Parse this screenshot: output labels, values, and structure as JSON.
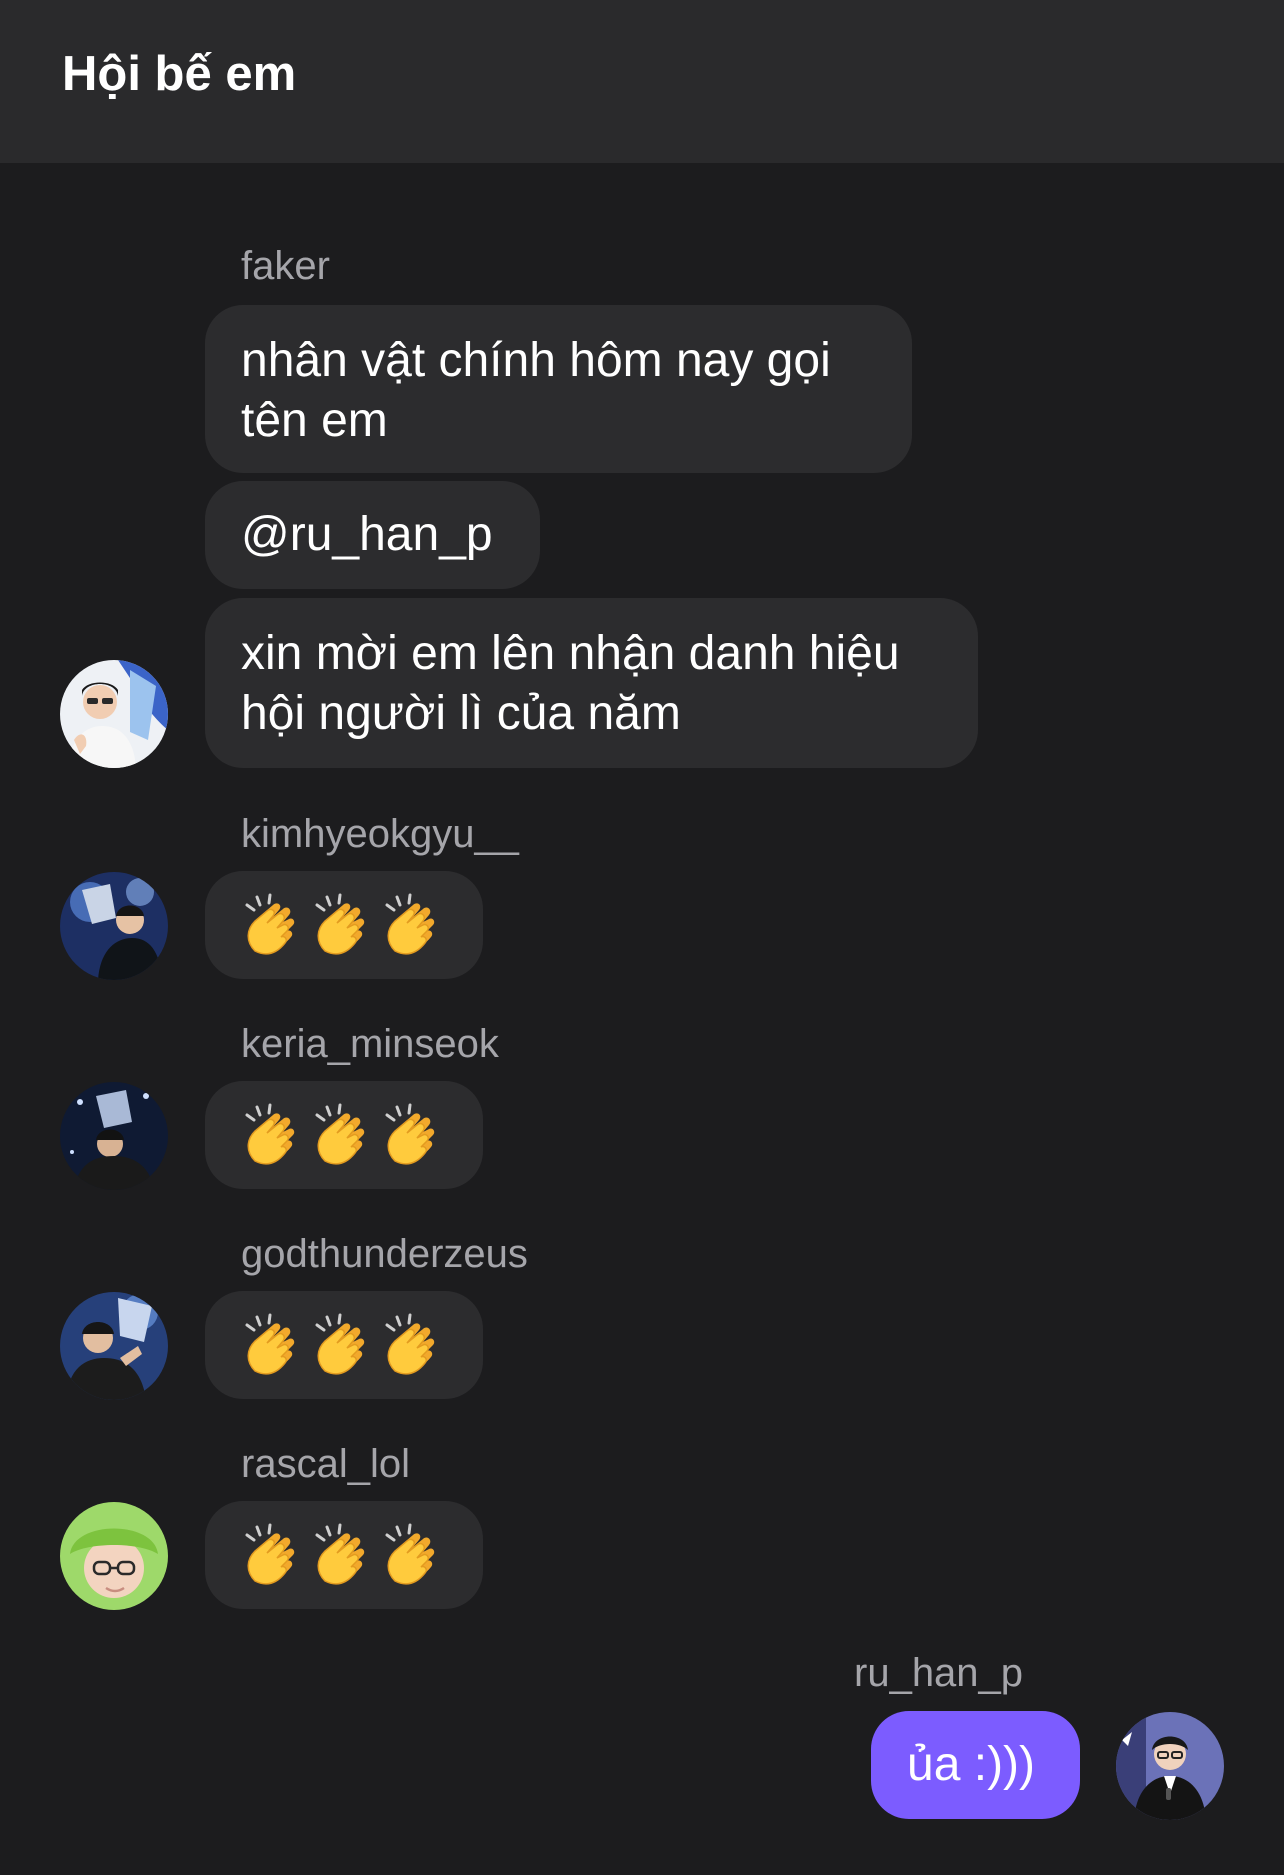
{
  "header": {
    "title": "Hội bế em"
  },
  "messages": [
    {
      "sender": "faker",
      "bubbles": [
        "nhân vật chính hôm nay gọi tên em",
        "@ru_han_p",
        "xin mời em lên nhận danh hiệu hội người lì của năm"
      ]
    },
    {
      "sender": "kimhyeokgyu__",
      "reaction": "clapping-hands x3"
    },
    {
      "sender": "keria_minseok",
      "reaction": "clapping-hands x3"
    },
    {
      "sender": "godthunderzeus",
      "reaction": "clapping-hands x3"
    },
    {
      "sender": "rascal_lol",
      "reaction": "clapping-hands x3"
    }
  ],
  "own_message": {
    "sender": "ru_han_p",
    "text": "ủa :)))"
  },
  "colors": {
    "background": "#1c1c1e",
    "header": "#2a2a2c",
    "bubble": "#2c2c2e",
    "own_bubble": "#7c5cff",
    "sender": "#a5a5aa"
  }
}
